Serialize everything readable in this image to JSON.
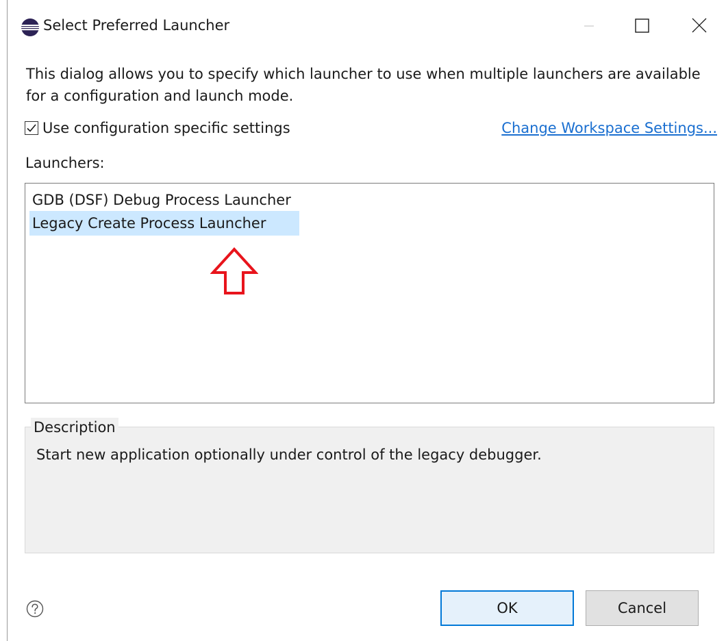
{
  "window": {
    "title": "Select Preferred Launcher",
    "icon": "eclipse-icon"
  },
  "dialog": {
    "intro": "This dialog allows you to specify which launcher to use when multiple launchers are available for a configuration and launch mode.",
    "use_config_specific": {
      "label": "Use configuration specific settings",
      "checked": true
    },
    "change_workspace_link": "Change Workspace Settings...",
    "launchers_label": "Launchers:",
    "launchers": [
      {
        "label": "GDB (DSF) Debug Process Launcher",
        "selected": false
      },
      {
        "label": "Legacy Create Process Launcher",
        "selected": true
      }
    ],
    "description": {
      "legend": "Description",
      "text": "Start new application optionally under control of the legacy debugger."
    },
    "buttons": {
      "ok": "OK",
      "cancel": "Cancel"
    }
  },
  "colors": {
    "selection": "#cce8ff",
    "link": "#1a6fd0",
    "ok_border": "#0078d7",
    "annotation_arrow": "#e8141c"
  }
}
